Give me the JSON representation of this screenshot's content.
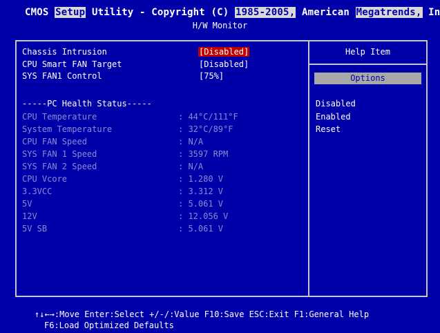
{
  "header": {
    "title_pre": "CMOS ",
    "title_setup": "Setup",
    "title_mid1": " Utility - Copyright (C) ",
    "title_years": "1985-2005,",
    "title_mid2": " American ",
    "title_megatrends": "Megatrends,",
    "title_post": " Inc.",
    "subtitle": "H/W Monitor"
  },
  "settings": [
    {
      "label": "Chassis Intrusion",
      "value": "[Disabled]",
      "selected": true
    },
    {
      "label": "CPU Smart FAN Target",
      "value": "[Disabled]",
      "selected": false
    },
    {
      "label": "SYS FAN1 Control",
      "value": "[75%]",
      "selected": false
    }
  ],
  "health": {
    "title": "-----PC Health Status-----",
    "rows": [
      {
        "label": "CPU Temperature",
        "value": ": 44°C/111°F"
      },
      {
        "label": "System Temperature",
        "value": ": 32°C/89°F"
      },
      {
        "label": "CPU FAN Speed",
        "value": ": N/A"
      },
      {
        "label": "SYS FAN 1 Speed",
        "value": ": 3597 RPM"
      },
      {
        "label": "SYS FAN 2 Speed",
        "value": ": N/A"
      },
      {
        "label": "CPU Vcore",
        "value": ": 1.280 V"
      },
      {
        "label": "3.3VCC",
        "value": ": 3.312 V"
      },
      {
        "label": "5V",
        "value": ": 5.061 V"
      },
      {
        "label": "12V",
        "value": ": 12.056 V"
      },
      {
        "label": "5V SB",
        "value": ": 5.061 V"
      }
    ]
  },
  "help": {
    "title": "Help Item",
    "options_label": "Options",
    "options": [
      "Disabled",
      "Enabled",
      "Reset"
    ]
  },
  "footer": {
    "line1": "↑↓←→:Move  Enter:Select  +/-/:Value  F10:Save  ESC:Exit  F1:General Help",
    "line2": "F6:Load Optimized Defaults"
  },
  "colors": {
    "background": "#0000a8",
    "selected_value_bg": "#c00000",
    "options_bar_bg": "#a8a8a8",
    "dimmed_text": "#8a8ad8",
    "border": "#c8c8c8"
  }
}
